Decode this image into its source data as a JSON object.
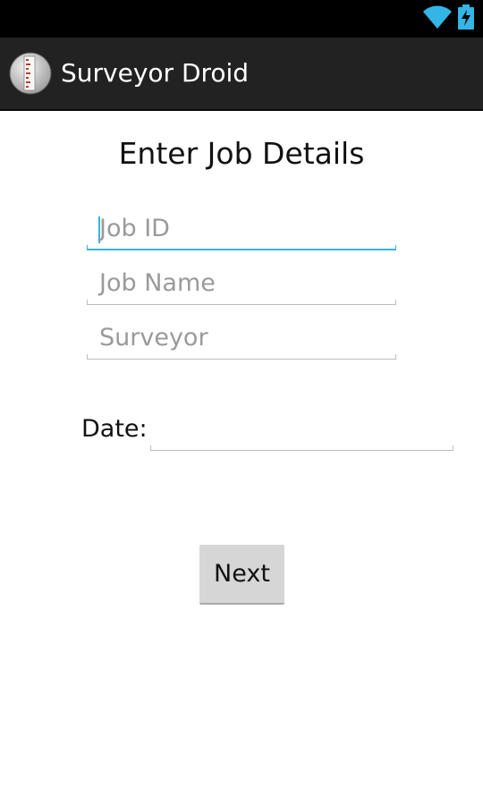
{
  "status_bar": {
    "wifi_icon": "wifi-icon",
    "battery_icon": "battery-charging-icon",
    "accent_color": "#33b5e5"
  },
  "action_bar": {
    "app_icon": "surveyor-ruler-app-icon",
    "title": "Surveyor Droid"
  },
  "form": {
    "heading": "Enter Job Details",
    "job_id": {
      "value": "",
      "placeholder": "Job ID",
      "focused": true
    },
    "job_name": {
      "value": "",
      "placeholder": "Job Name"
    },
    "surveyor": {
      "value": "",
      "placeholder": "Surveyor"
    },
    "date_label": "Date:",
    "date_value": "",
    "next_label": "Next"
  },
  "colors": {
    "focus_underline": "#33b5e5",
    "action_bar_bg": "#222222",
    "button_bg": "#d6d6d6"
  }
}
